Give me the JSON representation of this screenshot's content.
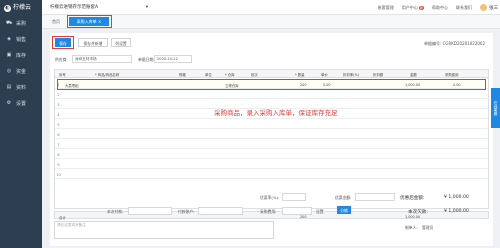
{
  "app": {
    "name": "柠檬云",
    "store": "柠檬云进销存示范账套A"
  },
  "topbar": {
    "items": [
      "账套管理",
      "用户中心",
      "帮助中心",
      "联系我们"
    ],
    "badge": "新",
    "user": "张三"
  },
  "sidebar": {
    "items": [
      {
        "label": "采购",
        "icon": "cart-icon"
      },
      {
        "label": "销售",
        "icon": "tag-icon"
      },
      {
        "label": "库存",
        "icon": "box-icon"
      },
      {
        "label": "资金",
        "icon": "wallet-icon"
      },
      {
        "label": "资料",
        "icon": "folder-icon"
      },
      {
        "label": "设置",
        "icon": "gear-icon"
      }
    ]
  },
  "tabs": {
    "home": "首页",
    "active": "采购入库单",
    "close": "×"
  },
  "toolbar": {
    "save": "保存",
    "save_new": "保存并新增",
    "columns": "列设置",
    "order_no_label": "单据编号:",
    "order_no": "CGRKD20201022002"
  },
  "form": {
    "supplier_label": "供应商:",
    "supplier": "深圳五材市场",
    "date_label": "单据日期:",
    "date": "2020-10-22"
  },
  "grid": {
    "headers": [
      "序号",
      "* 商品/商品名称",
      "规格",
      "单位",
      "* 仓库",
      "批次",
      "* 数量",
      "单价",
      "折扣率(%)",
      "折扣额",
      "金额",
      "采购费用"
    ],
    "row": {
      "num": "1",
      "product": "大荔枣稻",
      "warehouse": "立得仓库",
      "qty": "200",
      "price": "5.00",
      "amount": "1,000.00",
      "cost": "0.00"
    },
    "row_count": 10,
    "total_label": "合计",
    "total_qty": "200",
    "total_amount": "1,000.00"
  },
  "annotation": "采购商品，录入采购入库单，保证库存充足",
  "footer": {
    "discount_rate_label": "优惠率(%):",
    "discount_amount_label": "优惠金额:",
    "after_discount_label": "优惠后金额:",
    "after_discount_value": "¥ 1,000.00",
    "paid_label": "本次付款:",
    "account_label": "付款账户:",
    "fee_label": "采购费用:",
    "settings": "设置",
    "share": "分摊",
    "debt_label": "本次欠款:",
    "debt_value": "¥ 1,000.00",
    "remark_placeholder": "请在这里填写备注",
    "maker_label": "制单人:",
    "maker": "管理员"
  },
  "side_tab": "在线客服"
}
